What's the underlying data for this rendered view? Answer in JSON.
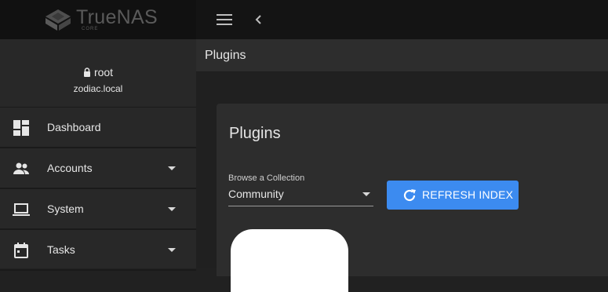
{
  "topbar": {
    "logo_text": "TrueNAS",
    "logo_sub": "CORE"
  },
  "user": {
    "name": "root",
    "host": "zodiac.local"
  },
  "sidebar": {
    "items": [
      {
        "label": "Dashboard",
        "icon": "dashboard-icon",
        "expandable": false
      },
      {
        "label": "Accounts",
        "icon": "people-icon",
        "expandable": true
      },
      {
        "label": "System",
        "icon": "laptop-icon",
        "expandable": true
      },
      {
        "label": "Tasks",
        "icon": "calendar-icon",
        "expandable": true
      }
    ]
  },
  "page": {
    "header_title": "Plugins",
    "card_title": "Plugins"
  },
  "collection": {
    "label": "Browse a Collection",
    "value": "Community"
  },
  "actions": {
    "refresh_label": "REFRESH INDEX"
  },
  "colors": {
    "accent": "#3c8bf0",
    "sidebar_bg": "#282828",
    "topbar_bg": "#141414"
  }
}
